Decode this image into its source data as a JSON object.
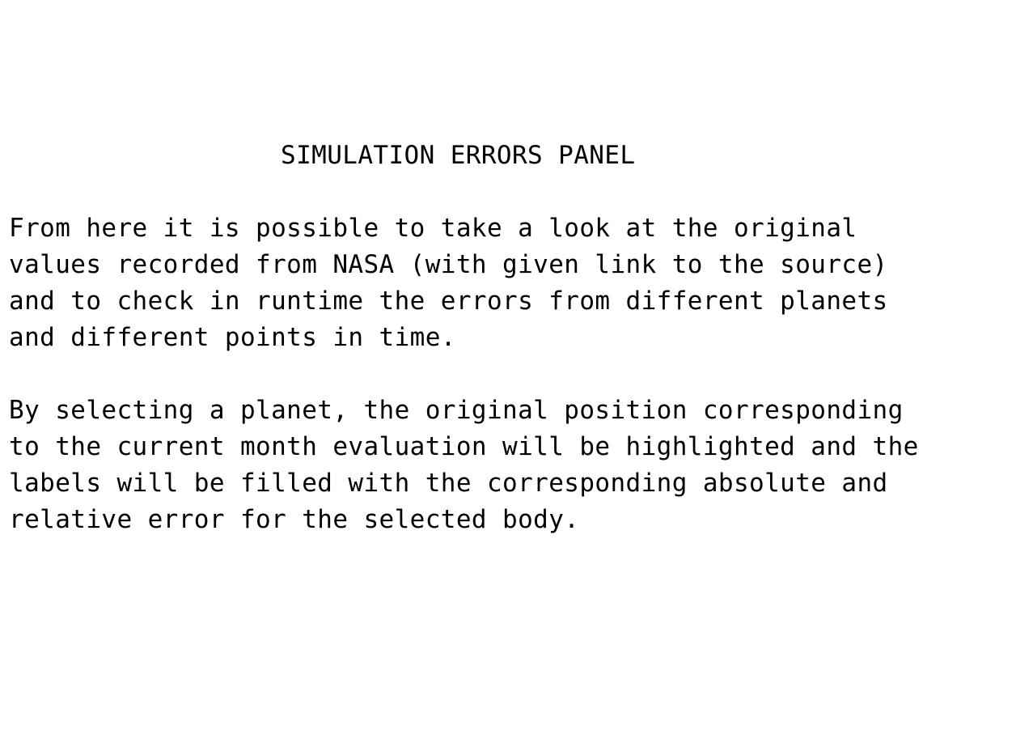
{
  "title": "SIMULATION ERRORS PANEL",
  "paragraph_1": [
    "From here it is possible to take a look at the original",
    "values recorded from NASA (with given link to the source)",
    "and to check in runtime the errors from different planets",
    "and different points in time."
  ],
  "paragraph_2": [
    "By selecting a planet, the original position corresponding",
    "to the current month evaluation will be highlighted and the",
    "labels will be filled with the corresponding absolute and",
    "relative error for the selected body."
  ]
}
